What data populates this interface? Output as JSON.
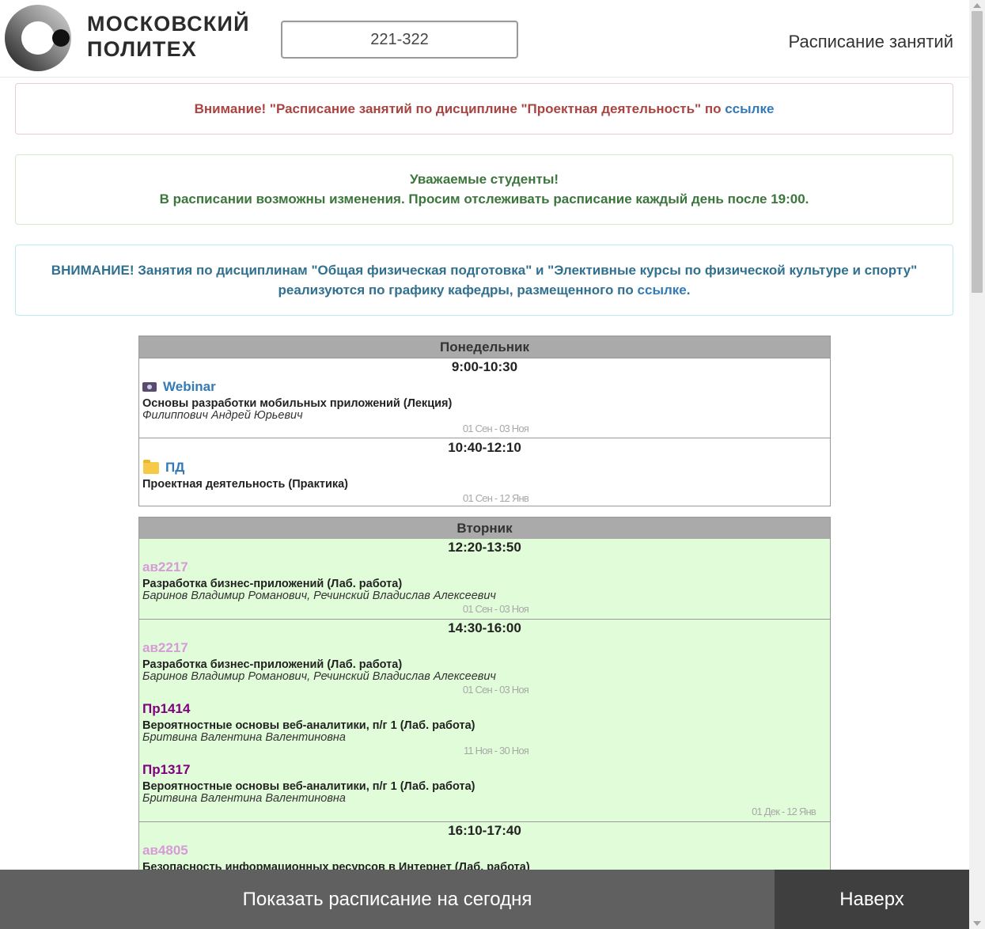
{
  "header": {
    "logo_text_line1": "МОСКОВСКИЙ",
    "logo_text_line2": "ПОЛИТЕХ",
    "group_value": "221-322",
    "site_title": "Расписание занятий"
  },
  "alerts": {
    "project": {
      "text": "Внимание! \"Расписание занятий по дисциплине \"Проектная деятельность\" по ",
      "link": "ссылке"
    },
    "students": {
      "line1": "Уважаемые студенты!",
      "line2": "В расписании возможны изменения. Просим отслеживать расписание каждый день после 19:00."
    },
    "pe": {
      "strong": "ВНИМАНИЕ!",
      "text": " Занятия по дисциплинам \"Общая физическая подготовка\" и \"Элективные курсы по физической культуре и спорту\" реализуются по графику кафедры, размещенного по ",
      "link": "ссылке",
      "end": "."
    }
  },
  "schedule": {
    "monday": {
      "name": "Понедельник",
      "slots": [
        {
          "time": "9:00-10:30",
          "lessons": [
            {
              "icon": "camera-icon",
              "place": "Webinar",
              "subject": "Основы разработки мобильных приложений (Лекция)",
              "teacher": "Филиппович Андрей Юрьевич",
              "dates": "01 Сен - 03 Ноя"
            }
          ]
        },
        {
          "time": "10:40-12:10",
          "lessons": [
            {
              "icon": "folder-icon",
              "place": "ПД",
              "subject": "Проектная деятельность (Практика)",
              "teacher": "",
              "dates": "01 Сен - 12 Янв"
            }
          ]
        }
      ]
    },
    "tuesday": {
      "name": "Вторник",
      "slots": [
        {
          "time": "12:20-13:50",
          "lessons": [
            {
              "place": "ав2217",
              "subject": "Разработка бизнес-приложений (Лаб. работа)",
              "teacher": "Баринов Владимир Романович, Речинский Владислав Алексеевич",
              "dates": "01 Сен - 03 Ноя"
            }
          ]
        },
        {
          "time": "14:30-16:00",
          "lessons": [
            {
              "place": "ав2217",
              "subject": "Разработка бизнес-приложений (Лаб. работа)",
              "teacher": "Баринов Владимир Романович, Речинский Владислав Алексеевич",
              "dates": "01 Сен - 03 Ноя"
            },
            {
              "place": "Пр1414",
              "subject": "Вероятностные основы веб-аналитики, п/г 1 (Лаб. работа)",
              "teacher": "Бритвина Валентина Валентиновна",
              "dates": "11 Ноя - 30 Ноя"
            },
            {
              "place": "Пр1317",
              "subject": "Вероятностные основы веб-аналитики, п/г 1 (Лаб. работа)",
              "teacher": "Бритвина Валентина Валентиновна",
              "dates": "01 Дек - 12 Янв"
            }
          ]
        },
        {
          "time": "16:10-17:40",
          "lessons": [
            {
              "place": "ав4805",
              "subject": "Безопасность информационных ресурсов в Интернет (Лаб. работа)"
            }
          ]
        }
      ]
    }
  },
  "bottom_bar": {
    "today_label": "Показать расписание на сегодня",
    "top_label": "Наверх"
  }
}
